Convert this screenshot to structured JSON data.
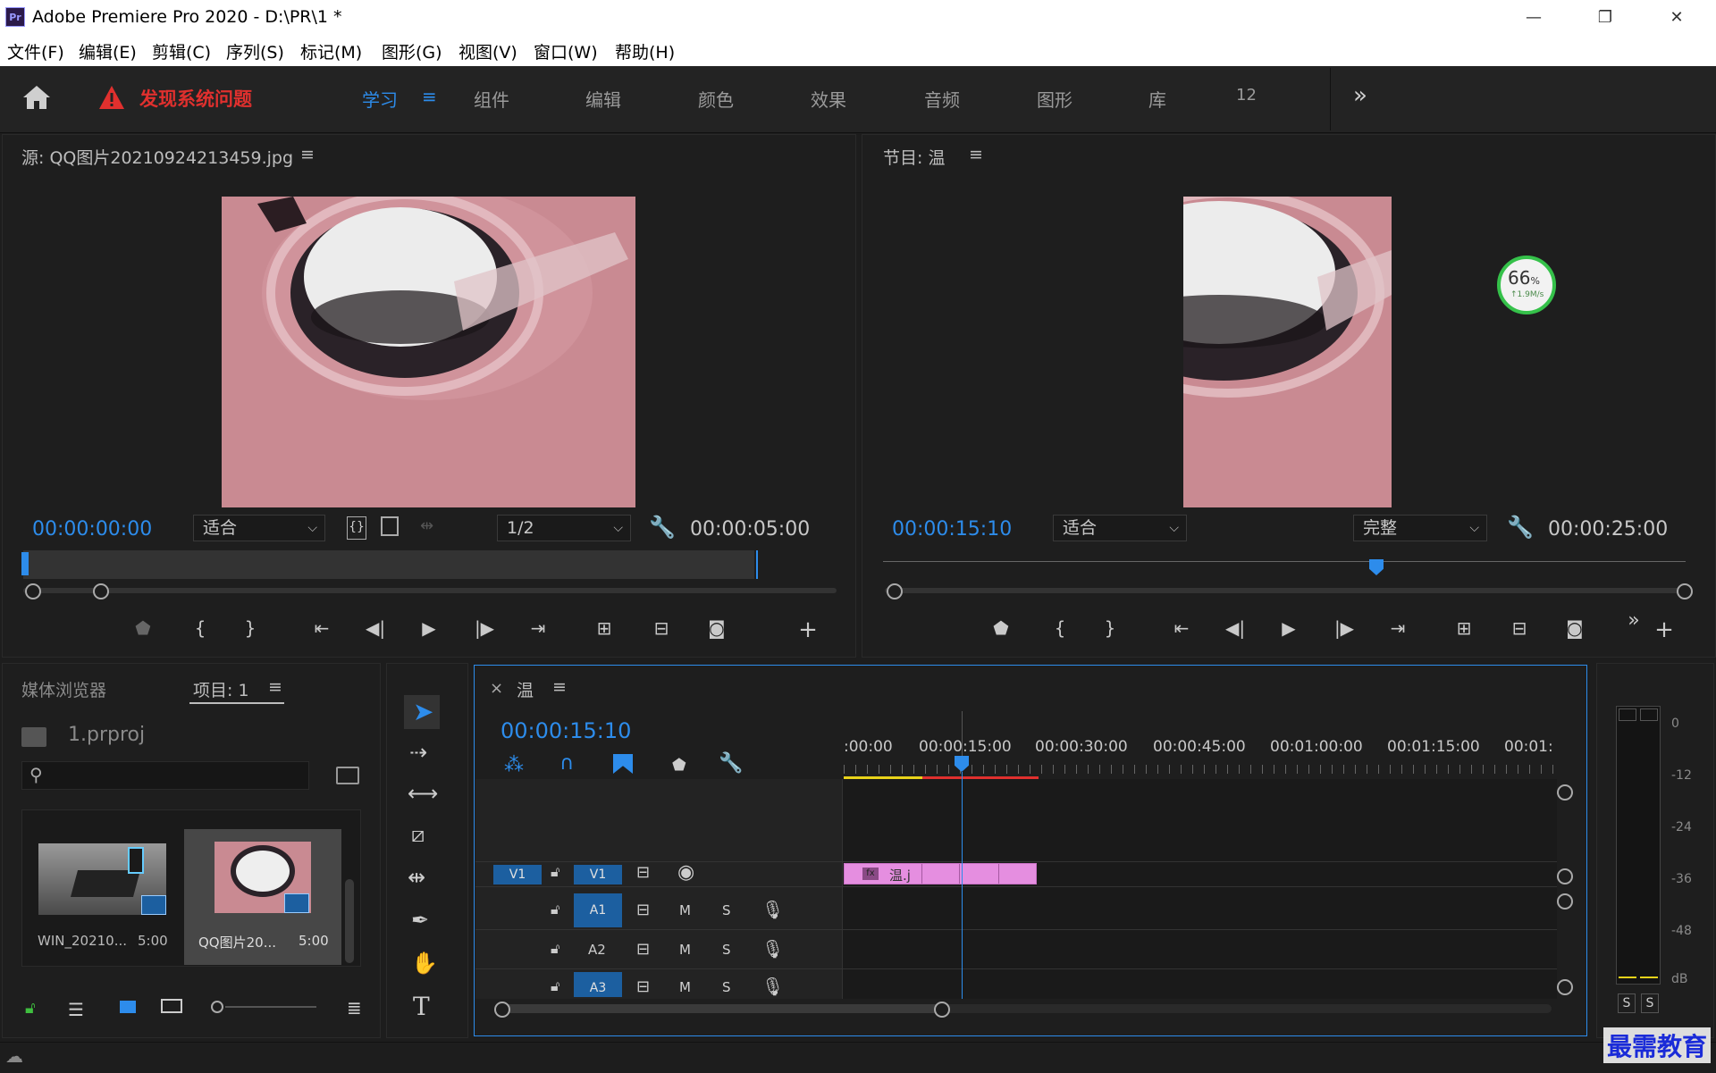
{
  "window": {
    "logo": "Pr",
    "title": "Adobe Premiere Pro 2020 - D:\\PR\\1 *",
    "minimize": "—",
    "restore": "❐",
    "close": "✕"
  },
  "menu": [
    "文件(F)",
    "编辑(E)",
    "剪辑(C)",
    "序列(S)",
    "标记(M)",
    "图形(G)",
    "视图(V)",
    "窗口(W)",
    "帮助(H)"
  ],
  "workspace": {
    "warning": "发现系统问题",
    "tabs": [
      "学习",
      "组件",
      "编辑",
      "颜色",
      "效果",
      "音频",
      "图形",
      "库",
      "12"
    ],
    "active_tab": "学习",
    "more": "»"
  },
  "source_monitor": {
    "title": "源: QQ图片20210924213459.jpg",
    "timecode": "00:00:00:00",
    "fit": "适合",
    "resolution": "1/2",
    "duration": "00:00:05:00"
  },
  "program_monitor": {
    "title": "节目: 温",
    "timecode": "00:00:15:10",
    "fit": "适合",
    "quality": "完整",
    "duration": "00:00:25:00",
    "net_percent": "66",
    "net_percent_unit": "%",
    "net_speed": "↑1.9M/s"
  },
  "project": {
    "tab_media": "媒体浏览器",
    "tab_project": "项目: 1",
    "file": "1.prproj",
    "search_placeholder": "",
    "items": [
      {
        "name": "WIN_20210...",
        "duration": "5:00"
      },
      {
        "name": "QQ图片20...",
        "duration": "5:00"
      }
    ]
  },
  "timeline": {
    "close": "×",
    "title": "温",
    "timecode": "00:00:15:10",
    "ruler": [
      ":00:00",
      "00:00:15:00",
      "00:00:30:00",
      "00:00:45:00",
      "00:01:00:00",
      "00:01:15:00",
      "00:01:"
    ],
    "tracks": {
      "v1_src": "V1",
      "v1": "V1",
      "a1": "A1",
      "a2": "A2",
      "a3": "A3",
      "mute": "M",
      "solo": "S"
    },
    "clip_fx": "fx",
    "clip_name": "温.j"
  },
  "meter": {
    "labels": [
      "0",
      "-12",
      "-24",
      "-36",
      "-48",
      "dB"
    ],
    "solo_left": "S",
    "solo_right": "S"
  },
  "watermark": "最需教育"
}
